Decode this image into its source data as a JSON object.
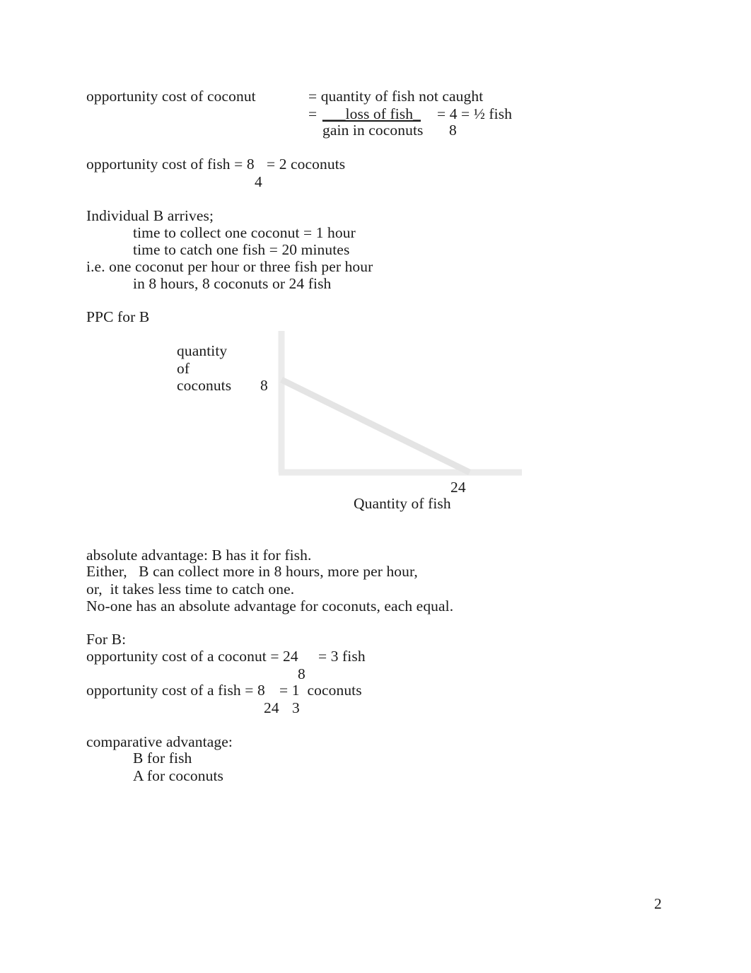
{
  "document": {
    "page_number": "2",
    "body": {
      "opportunity_cost_coconut": {
        "label": "opportunity cost of coconut",
        "line1": "= quantity of fish not caught",
        "line2_eq": "=",
        "numerator": "___loss of fish_",
        "denominator": "gain in coconuts",
        "result_numerator": "= 4 = ½ fish",
        "result_denominator": "8"
      },
      "opportunity_cost_fish": {
        "line": "opportunity cost of fish = 8",
        "result": "= 2 coconuts",
        "denominator": "4"
      },
      "individual_b": {
        "heading": "Individual B arrives;",
        "line_coconut_time": "time to collect one coconut = 1 hour",
        "line_fish_time": "time to catch one fish = 20 minutes",
        "line_rate": "i.e. one coconut per hour or three fish per hour",
        "line_eight_hours": "in 8 hours, 8 coconuts or 24 fish"
      },
      "ppc_heading": "PPC for B",
      "absolute_advantage": {
        "line1": "absolute advantage: B has it for fish.",
        "line2": "Either,   B can collect more in 8 hours, more per hour,",
        "line3": "or,  it takes less time to catch one.",
        "line4": "No-one has an absolute advantage for coconuts, each equal."
      },
      "for_b": {
        "heading": "For B:",
        "coconut_line": "opportunity cost of a coconut = 24",
        "coconut_result": "= 3 fish",
        "coconut_denominator": "8",
        "fish_line": "opportunity cost of a fish = 8",
        "fish_result": "= 1  coconuts",
        "fish_denominator_left": "24",
        "fish_denominator_right": "3"
      },
      "comparative_advantage": {
        "heading": "comparative advantage:",
        "line1": "B for fish",
        "line2": "A for coconuts"
      }
    }
  },
  "chart_data": {
    "type": "line",
    "title": "PPC for B",
    "xlabel": "Quantity of fish",
    "ylabel_lines": [
      "quantity",
      "of",
      "coconuts"
    ],
    "y_tick_label": "8",
    "x_tick_label": "24",
    "xlim": [
      0,
      24
    ],
    "ylim": [
      0,
      8
    ],
    "grid": false,
    "legend": "none",
    "axis_color": "#ebebeb",
    "line_color": "#e4e4e4",
    "series": [
      {
        "name": "PPC for B",
        "x": [
          0,
          24
        ],
        "y": [
          8,
          0
        ]
      }
    ]
  }
}
